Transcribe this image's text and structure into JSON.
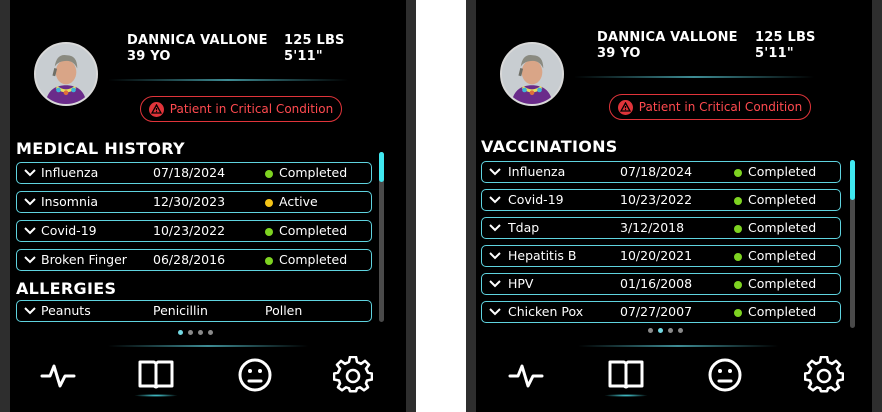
{
  "screens": [
    {
      "patient": {
        "name": "DANNICA VALLONE",
        "age": "39 YO",
        "weight": "125 LBS",
        "height": "5'11\""
      },
      "alert": {
        "text": "Patient in Critical Condition",
        "icon": "warning-triangle-icon"
      },
      "sections": [
        {
          "title": "MEDICAL HISTORY",
          "rows": [
            {
              "name": "Influenza",
              "date": "07/18/2024",
              "status": "Completed",
              "status_color": "#7ed321"
            },
            {
              "name": "Insomnia",
              "date": "12/30/2023",
              "status": "Active",
              "status_color": "#f5c518"
            },
            {
              "name": "Covid-19",
              "date": "10/23/2022",
              "status": "Completed",
              "status_color": "#7ed321"
            },
            {
              "name": "Broken Finger",
              "date": "06/28/2016",
              "status": "Completed",
              "status_color": "#7ed321"
            }
          ]
        },
        {
          "title": "ALLERGIES",
          "rows": [
            {
              "name": "Peanuts",
              "col2": "Penicillin",
              "col3": "Pollen"
            }
          ]
        }
      ],
      "pager": {
        "count": 4,
        "active": 1
      },
      "nav": [
        "pulse-icon",
        "book-icon",
        "neutral-face-icon",
        "gear-icon"
      ],
      "nav_active": 1
    },
    {
      "patient": {
        "name": "DANNICA VALLONE",
        "age": "39 YO",
        "weight": "125 LBS",
        "height": "5'11\""
      },
      "alert": {
        "text": "Patient in Critical Condition",
        "icon": "warning-triangle-icon"
      },
      "sections": [
        {
          "title": "VACCINATIONS",
          "rows": [
            {
              "name": "Influenza",
              "date": "07/18/2024",
              "status": "Completed",
              "status_color": "#7ed321"
            },
            {
              "name": "Covid-19",
              "date": "10/23/2022",
              "status": "Completed",
              "status_color": "#7ed321"
            },
            {
              "name": "Tdap",
              "date": "3/12/2018",
              "status": "Completed",
              "status_color": "#7ed321"
            },
            {
              "name": "Hepatitis B",
              "date": "10/20/2021",
              "status": "Completed",
              "status_color": "#7ed321"
            },
            {
              "name": "HPV",
              "date": "01/16/2008",
              "status": "Completed",
              "status_color": "#7ed321"
            },
            {
              "name": "Chicken Pox",
              "date": "07/27/2007",
              "status": "Completed",
              "status_color": "#7ed321"
            }
          ]
        }
      ],
      "pager": {
        "count": 4,
        "active": 2
      },
      "nav": [
        "pulse-icon",
        "book-icon",
        "neutral-face-icon",
        "gear-icon"
      ],
      "nav_active": 1
    }
  ],
  "colors": {
    "accent": "#5fd3df",
    "alert": "#e0343a",
    "completed": "#7ed321",
    "active": "#f5c518"
  }
}
